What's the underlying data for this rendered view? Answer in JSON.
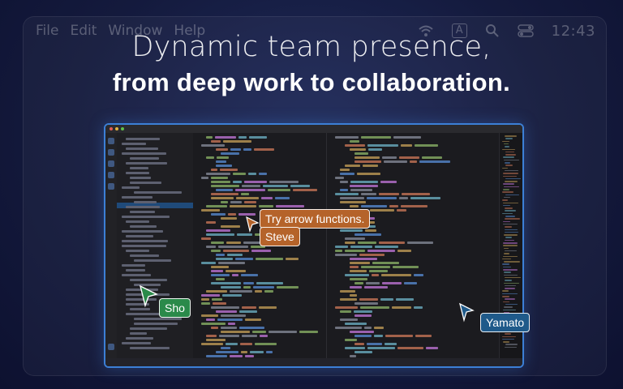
{
  "menubar": {
    "items": [
      "File",
      "Edit",
      "Window",
      "Help"
    ],
    "clock": "12:43",
    "status_icons": [
      "wifi-icon",
      "input-method-icon",
      "search-icon",
      "control-center-icon"
    ],
    "input_method_label": "A"
  },
  "headline": {
    "line1": "Dynamic team presence,",
    "line2": "from deep work to collaboration."
  },
  "editor": {
    "accent_border": "#3c7fd6"
  },
  "collaborators": [
    {
      "name": "Sho",
      "color": "#2a8a4a"
    },
    {
      "name": "Steve",
      "color": "#b5632a"
    },
    {
      "name": "Yamato",
      "color": "#1f5a8a"
    }
  ],
  "comment": {
    "text": "Try arrow functions.",
    "color": "#b5632a"
  }
}
